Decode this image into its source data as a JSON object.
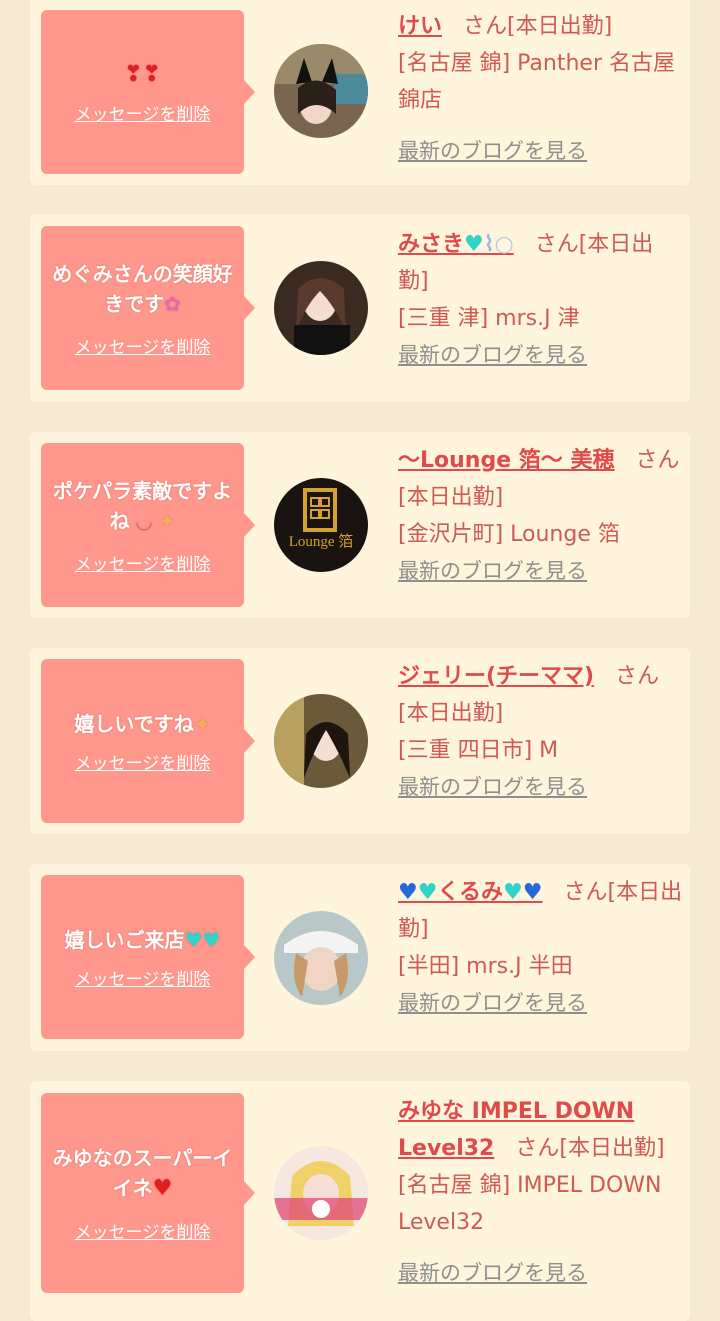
{
  "common": {
    "delete_label": "メッセージを削除",
    "blog_label": "最新のブログを見る",
    "san": "さん",
    "today": "[本日出勤]"
  },
  "cards": [
    {
      "message": "",
      "name": "けい",
      "shop": "[名古屋 錦] Panther 名古屋錦店"
    },
    {
      "message": "めぐみさんの笑顔好きです",
      "name": "みさき",
      "shop": "[三重 津] mrs.J 津"
    },
    {
      "message": "ポケパラ素敵ですよね",
      "name": "〜Lounge 箔〜 美穂",
      "shop": "[金沢片町] Lounge 箔"
    },
    {
      "message": "嬉しいですね",
      "name": "ジェリー(チーママ)",
      "shop": "[三重 四日市] M"
    },
    {
      "message": "嬉しいご来店",
      "name": "くるみ",
      "shop": "[半田] mrs.J 半田"
    },
    {
      "message": "みゆなのスーパーイイネ",
      "name": "みゆな IMPEL DOWN Level32",
      "shop": "[名古屋 錦] IMPEL DOWN Level32"
    }
  ],
  "avatar_logo_text": "Lounge 箔"
}
